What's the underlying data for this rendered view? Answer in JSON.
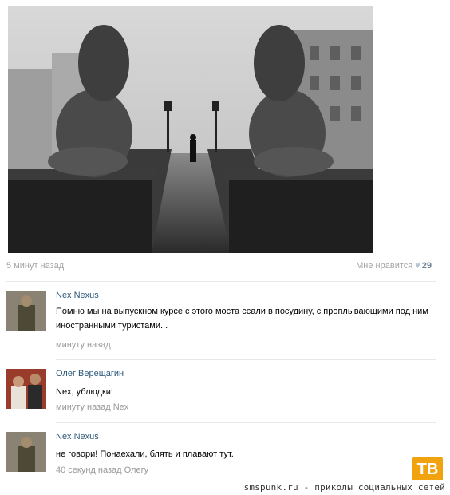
{
  "post": {
    "time": "5 минут назад",
    "like_label": "Мне нравится",
    "like_count": "29"
  },
  "comments": [
    {
      "author": "Nex Nexus",
      "text": "Помню мы на выпускном курсе с этого моста ссали в посудину, с проплывающими под ним иностранными туристами...",
      "time": "минуту назад"
    },
    {
      "author": "Олег Верещагин",
      "text": "Nex, ублюдки!",
      "time": "минуту назад Nex"
    },
    {
      "author": "Nex Nexus",
      "text": "не говори! Понаехали, блять и плавают тут.",
      "time": "40 секунд назад Олегу"
    }
  ],
  "footer": {
    "text": "smspunk.ru - приколы социальных сетей",
    "logo": "ТВ"
  },
  "colors": {
    "link": "#2b587a",
    "meta": "#a4a4a4",
    "logo_bg": "#f0a30f"
  }
}
